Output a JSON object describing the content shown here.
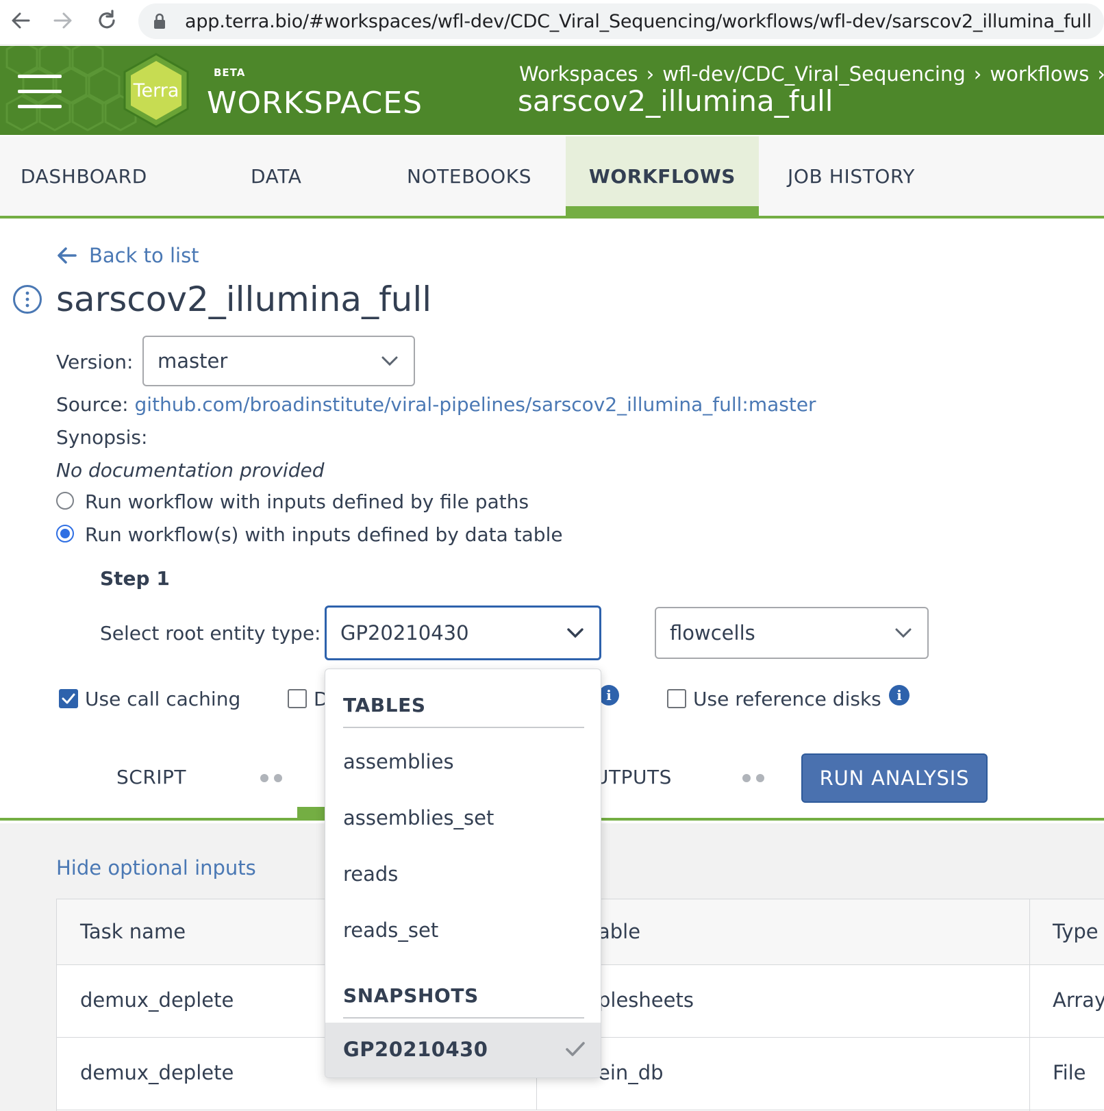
{
  "browser": {
    "url_host": "app.terra.bio",
    "url_path": "/#workspaces/wfl-dev/CDC_Viral_Sequencing/workflows/wfl-dev/sarscov2_illumina_full"
  },
  "header": {
    "logo_text": "Terra",
    "beta": "BETA",
    "app_title": "WORKSPACES",
    "breadcrumb": [
      "Workspaces",
      "wfl-dev/CDC_Viral_Sequencing",
      "workflows"
    ],
    "breadcrumb_sep": "›",
    "title": "sarscov2_illumina_full"
  },
  "tabs": [
    {
      "label": "DASHBOARD",
      "active": false
    },
    {
      "label": "DATA",
      "active": false
    },
    {
      "label": "NOTEBOOKS",
      "active": false
    },
    {
      "label": "WORKFLOWS",
      "active": true
    },
    {
      "label": "JOB HISTORY",
      "active": false
    }
  ],
  "main": {
    "back_link": "Back to list",
    "workflow_title": "sarscov2_illumina_full",
    "version_label": "Version:",
    "version_value": "master",
    "source_label": "Source:",
    "source_link": "github.com/broadinstitute/viral-pipelines/sarscov2_illumina_full:master",
    "synopsis_label": "Synopsis:",
    "synopsis_value": "No documentation provided",
    "radio_file_paths": "Run workflow with inputs defined by file paths",
    "radio_data_table": "Run workflow(s) with inputs defined by data table",
    "radio_selected": "data_table",
    "step_label": "Step 1",
    "root_entity_label": "Select root entity type:",
    "root_entity_value": "GP20210430",
    "second_select_value": "flowcells",
    "call_caching_label": "Use call caching",
    "call_caching_checked": true,
    "delete_label_partial": "D",
    "reference_disks_label": "Use reference disks",
    "reference_disks_checked": false
  },
  "subtabs": {
    "script": "SCRIPT",
    "outputs_partial": "UTPUTS",
    "run_button": "RUN ANALYSIS"
  },
  "inputs": {
    "hide_optional": "Hide optional inputs",
    "columns": [
      "Task name",
      "able",
      "Type"
    ],
    "rows": [
      {
        "task": "demux_deplete",
        "variable": "plesheets",
        "type": "Array"
      },
      {
        "task": "demux_deplete",
        "variable": "ein_db",
        "type": "File"
      }
    ]
  },
  "dropdown": {
    "group_tables": "TABLES",
    "tables": [
      "assemblies",
      "assemblies_set",
      "reads",
      "reads_set"
    ],
    "group_snapshots": "SNAPSHOTS",
    "snapshots": [
      "GP20210430"
    ],
    "selected": "GP20210430"
  },
  "colors": {
    "header_green": "#4d872a",
    "accent_green": "#74ae43",
    "link_blue": "#4a78b4",
    "primary_blue": "#4a71af",
    "text": "#333f52"
  }
}
